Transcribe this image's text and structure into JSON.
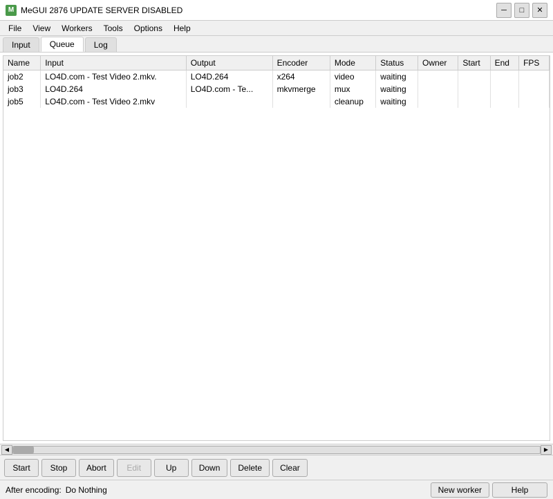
{
  "titleBar": {
    "icon": "M",
    "title": "MeGUI 2876 UPDATE SERVER DISABLED",
    "minimize": "─",
    "maximize": "□",
    "close": "✕"
  },
  "menuBar": {
    "items": [
      "File",
      "View",
      "Workers",
      "Tools",
      "Options",
      "Help"
    ]
  },
  "tabs": {
    "items": [
      "Input",
      "Queue",
      "Log"
    ],
    "active": 1
  },
  "table": {
    "columns": [
      "Name",
      "Input",
      "Output",
      "Encoder",
      "Mode",
      "Status",
      "Owner",
      "Start",
      "End",
      "FPS"
    ],
    "rows": [
      {
        "name": "job2",
        "input": "LO4D.com - Test Video 2.mkv.",
        "output": "LO4D.264",
        "encoder": "x264",
        "mode": "video",
        "status": "waiting",
        "owner": "",
        "start": "",
        "end": "",
        "fps": ""
      },
      {
        "name": "job3",
        "input": "LO4D.264",
        "output": "LO4D.com - Te...",
        "encoder": "mkvmerge",
        "mode": "mux",
        "status": "waiting",
        "owner": "",
        "start": "",
        "end": "",
        "fps": ""
      },
      {
        "name": "job5",
        "input": "LO4D.com - Test Video 2.mkv",
        "output": "",
        "encoder": "",
        "mode": "cleanup",
        "status": "waiting",
        "owner": "",
        "start": "",
        "end": "",
        "fps": ""
      }
    ]
  },
  "buttonBar": {
    "buttons": [
      {
        "label": "Start",
        "name": "start-button",
        "disabled": false
      },
      {
        "label": "Stop",
        "name": "stop-button",
        "disabled": false
      },
      {
        "label": "Abort",
        "name": "abort-button",
        "disabled": false
      },
      {
        "label": "Edit",
        "name": "edit-button",
        "disabled": true
      },
      {
        "label": "Up",
        "name": "up-button",
        "disabled": false
      },
      {
        "label": "Down",
        "name": "down-button",
        "disabled": false
      },
      {
        "label": "Delete",
        "name": "delete-button",
        "disabled": false
      },
      {
        "label": "Clear",
        "name": "clear-button",
        "disabled": false
      }
    ]
  },
  "statusBar": {
    "afterEncodingLabel": "After encoding:",
    "afterEncodingValue": "Do Nothing",
    "newWorkerLabel": "New worker",
    "helpLabel": "Help"
  }
}
